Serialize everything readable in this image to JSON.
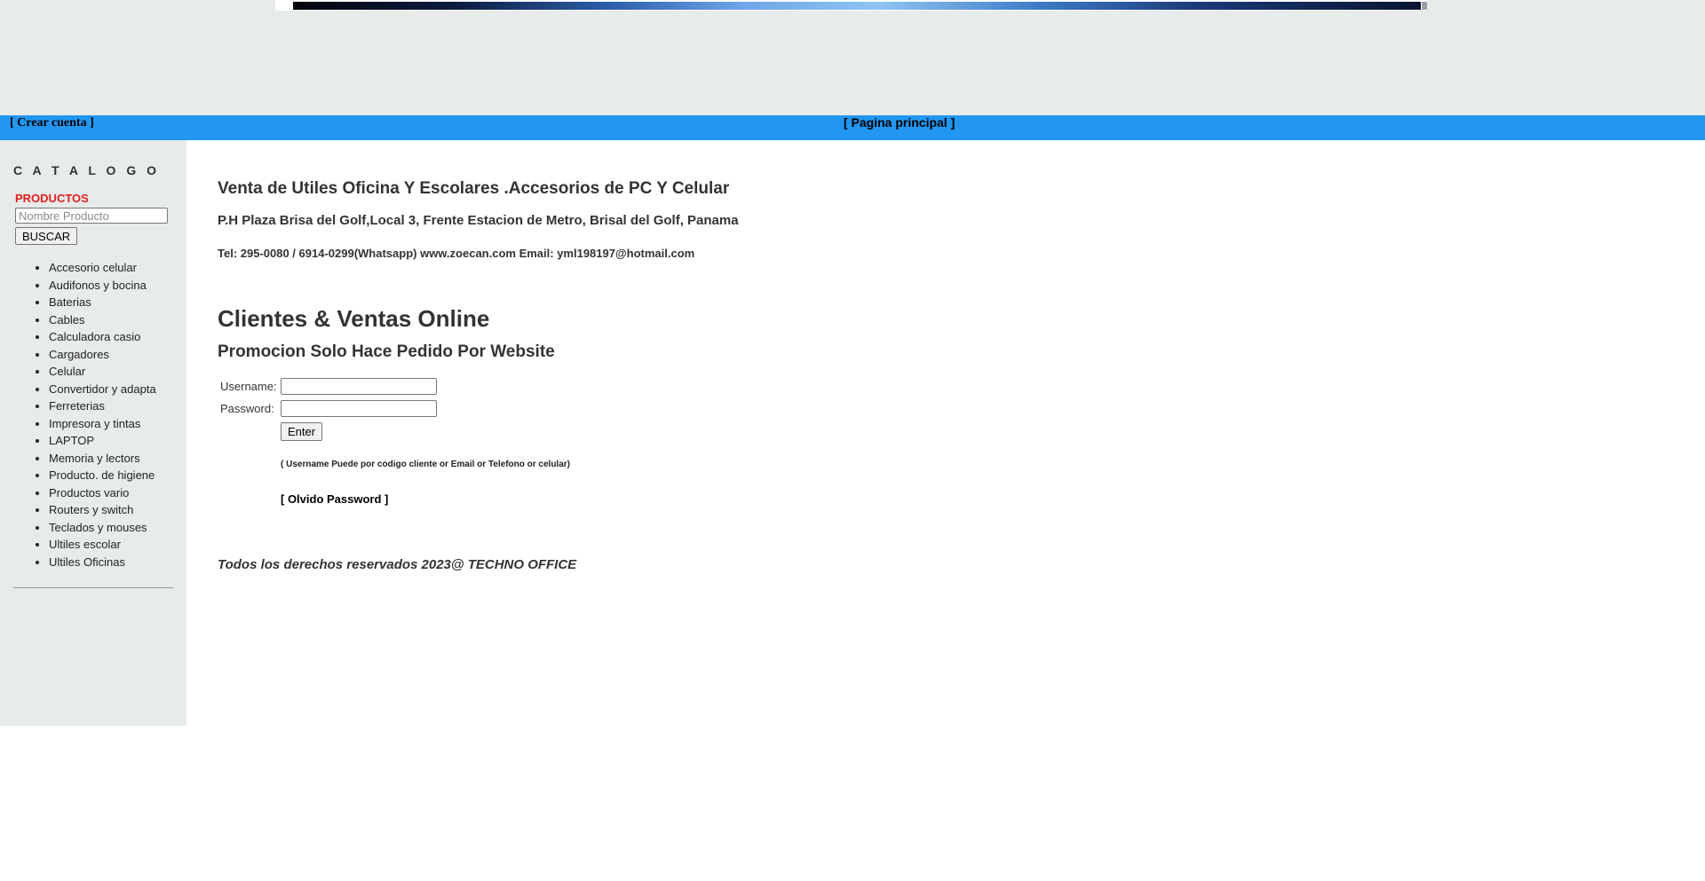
{
  "header": {
    "create_account_link": "[ Crear cuenta ]",
    "home_link": "[ Pagina principal ]",
    "bar_color": "#2196f3"
  },
  "sidebar": {
    "title": "C A T A L O G O",
    "products_label": "PRODUCTOS",
    "search": {
      "placeholder": "Nombre Producto",
      "value": "",
      "button_label": "BUSCAR"
    },
    "categories": [
      "Accesorio celular",
      "Audifonos y bocina",
      "Baterias",
      "Cables",
      "Calculadora casio",
      "Cargadores",
      "Celular",
      "Convertidor y adapta",
      "Ferreterias",
      "Impresora y tintas",
      "LAPTOP",
      "Memoria y lectors",
      "Producto. de higiene",
      "Productos vario",
      "Routers y switch",
      "Teclados y mouses",
      "Ultiles escolar",
      "Ultiles Oficinas"
    ]
  },
  "main": {
    "store_title": "Venta de Utiles Oficina Y Escolares .Accesorios de PC Y Celular",
    "address": "P.H Plaza Brisa del Golf,Local 3, Frente Estacion de Metro, Brisal del Golf, Panama",
    "contact": "Tel: 295-0080 / 6914-0299(Whatsapp) www.zoecan.com Email: yml198197@hotmail.com",
    "section_title": "Clientes & Ventas Online",
    "promo_title": "Promocion Solo Hace Pedido Por Website",
    "login": {
      "username_label": "Username:",
      "password_label": "Password:",
      "username_value": "",
      "password_value": "",
      "enter_button": "Enter",
      "hint": "( Username Puede por codigo cliente or Email or Telefono or celular)",
      "forgot_link": "[ Olvido Password ]"
    },
    "footer": "Todos los derechos reservados 2023@ TECHNO OFFICE"
  }
}
